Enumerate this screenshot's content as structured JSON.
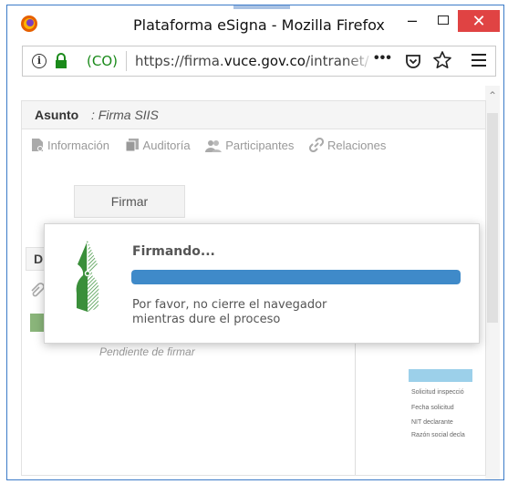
{
  "window": {
    "title": "Plataforma eSigna - Mozilla Firefox",
    "close_glyph": "✕",
    "minimize_glyph": "–"
  },
  "urlbar": {
    "site_identity": "(CO)",
    "url_prefix": "https://firma.",
    "url_domain": "vuce.gov.co",
    "url_path": "/intranet/",
    "more_glyph": "•••"
  },
  "page": {
    "asunto_label": "Asunto",
    "asunto_value": ": Firma SIIS",
    "tabs": [
      {
        "label": "Información",
        "icon": "document-info-icon"
      },
      {
        "label": "Auditoría",
        "icon": "copy-icon"
      },
      {
        "label": "Participantes",
        "icon": "users-icon"
      },
      {
        "label": "Relaciones",
        "icon": "link-icon"
      }
    ],
    "firmar_button": "Firmar",
    "doc_header_initial": "D",
    "pendiente": "Pendiente de firmar"
  },
  "preview": {
    "lines": [
      "Solicitud inspecció",
      "Fecha solicitud",
      "NIT declarante",
      "Razón social decla"
    ]
  },
  "dialog": {
    "title": "Firmando...",
    "progress": 1.0,
    "message_line1": "Por favor, no cierre el navegador",
    "message_line2": "mientras dure el proceso"
  },
  "colors": {
    "accent": "#3f8ac9",
    "brand_green": "#3a8f3a",
    "close_red": "#e04343",
    "secure_green": "#1a8a1a"
  }
}
